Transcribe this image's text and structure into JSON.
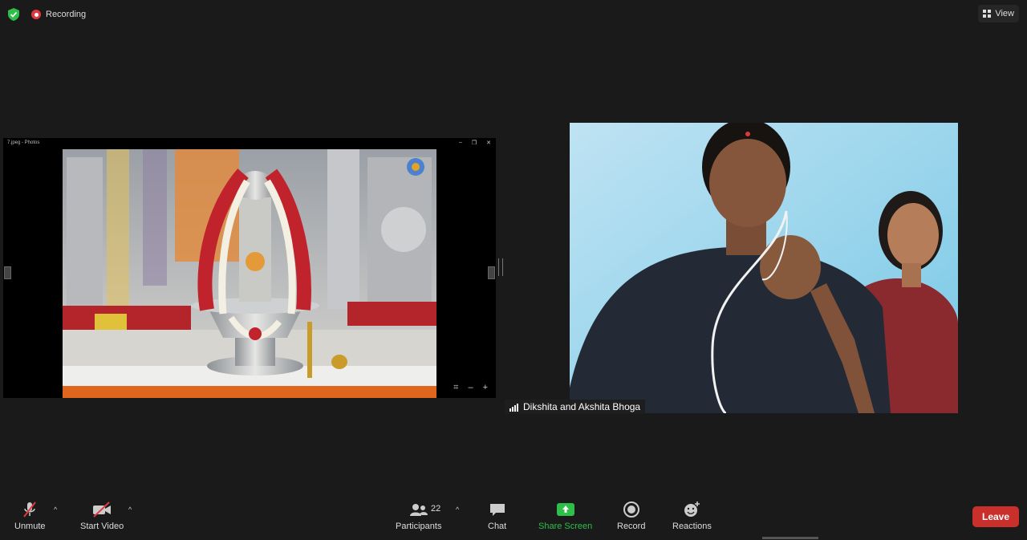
{
  "topbar": {
    "security_icon": "shield-check-icon",
    "recording_label": "Recording",
    "view_label": "View"
  },
  "shared_screen": {
    "window_title": "7.jpeg - Photos",
    "window_controls": [
      "–",
      "❐",
      "✕"
    ],
    "image_tools": [
      "⌗",
      "–",
      "+"
    ]
  },
  "participant": {
    "name": "Dikshita and Akshita  Bhoga"
  },
  "toolbar": {
    "unmute_label": "Unmute",
    "start_video_label": "Start Video",
    "participants_label": "Participants",
    "participants_count": "22",
    "chat_label": "Chat",
    "share_screen_label": "Share Screen",
    "record_label": "Record",
    "reactions_label": "Reactions",
    "leave_label": "Leave"
  },
  "colors": {
    "background": "#1a1a1a",
    "share_green": "#2dbf4a",
    "leave_red": "#c9302c",
    "recording_red": "#e0383e"
  }
}
